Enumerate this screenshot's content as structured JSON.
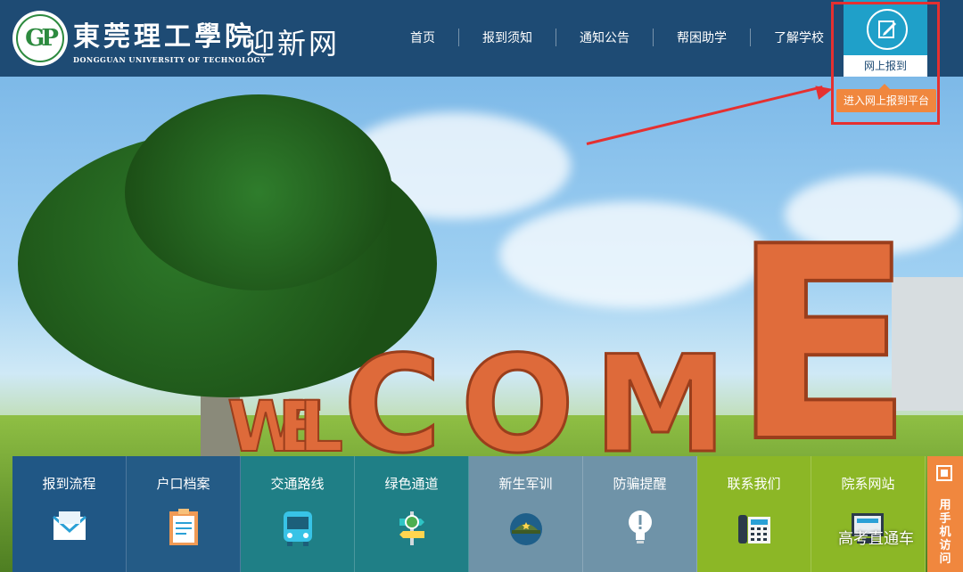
{
  "brand": {
    "name_cn": "東莞理工學院",
    "name_en": "DONGGUAN UNIVERSITY OF TECHNOLOGY",
    "site_name": "迎新网"
  },
  "nav": {
    "items": [
      "首页",
      "报到须知",
      "通知公告",
      "帮困助学",
      "了解学校"
    ]
  },
  "register": {
    "label": "网上报到",
    "enter_button": "进入网上报到平台"
  },
  "hero": {
    "word": "WELCOME"
  },
  "tiles": [
    {
      "label": "报到流程",
      "icon": "envelope-icon",
      "color": "#205785"
    },
    {
      "label": "户口档案",
      "icon": "clipboard-icon",
      "color": "#245b86"
    },
    {
      "label": "交通路线",
      "icon": "bus-icon",
      "color": "#1f7f86"
    },
    {
      "label": "绿色通道",
      "icon": "signpost-icon",
      "color": "#1f7f86"
    },
    {
      "label": "新生军训",
      "icon": "military-cap-icon",
      "color": "#6f93a8"
    },
    {
      "label": "防骗提醒",
      "icon": "lightbulb-icon",
      "color": "#6f93a8"
    },
    {
      "label": "联系我们",
      "icon": "telephone-icon",
      "color": "#8cb726"
    },
    {
      "label": "院系网站",
      "icon": "computer-icon",
      "color": "#8cb726"
    }
  ],
  "side_tab": {
    "label": "用手机访问"
  },
  "watermark": "高考直通车",
  "colors": {
    "header_bg": "#1e4b74",
    "register_bg": "#1fa0c9",
    "accent_orange": "#f0873e",
    "highlight_red": "#e53030"
  }
}
